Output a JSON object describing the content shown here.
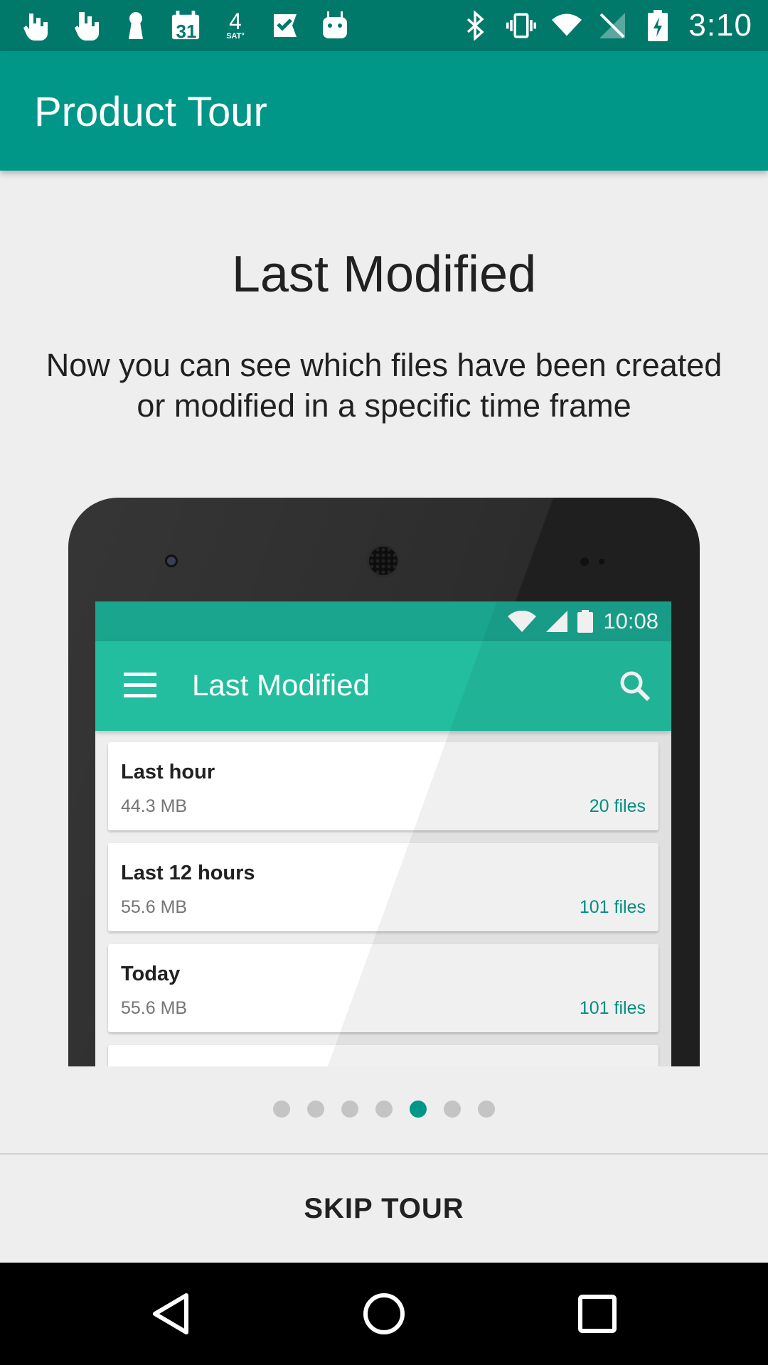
{
  "status_bar": {
    "time": "3:10",
    "left_icons": [
      "hand-icon",
      "hand-icon",
      "keyhole-icon",
      "calendar-icon",
      "weather-icon",
      "task-icon",
      "android-icon"
    ],
    "calendar_day": "31",
    "weather_day": "4",
    "weather_label": "SAT°",
    "right_icons": [
      "bluetooth-icon",
      "vibrate-icon",
      "wifi-icon",
      "no-sim-icon",
      "battery-charging-icon"
    ]
  },
  "app_bar": {
    "title": "Product Tour"
  },
  "slide": {
    "title": "Last Modified",
    "description": "Now you can see which files have been created or modified in a specific time frame"
  },
  "phone_screen": {
    "status_time": "10:08",
    "title": "Last Modified",
    "cards": [
      {
        "title": "Last hour",
        "size": "44.3 MB",
        "files": "20 files"
      },
      {
        "title": "Last 12 hours",
        "size": "55.6 MB",
        "files": "101 files"
      },
      {
        "title": "Today",
        "size": "55.6 MB",
        "files": "101 files"
      }
    ]
  },
  "pager": {
    "total": 7,
    "active_index": 4
  },
  "skip_button": {
    "label": "SKIP TOUR"
  },
  "colors": {
    "primary": "#009688",
    "primary_dark": "#00796b",
    "mock_primary": "#23be9f"
  }
}
